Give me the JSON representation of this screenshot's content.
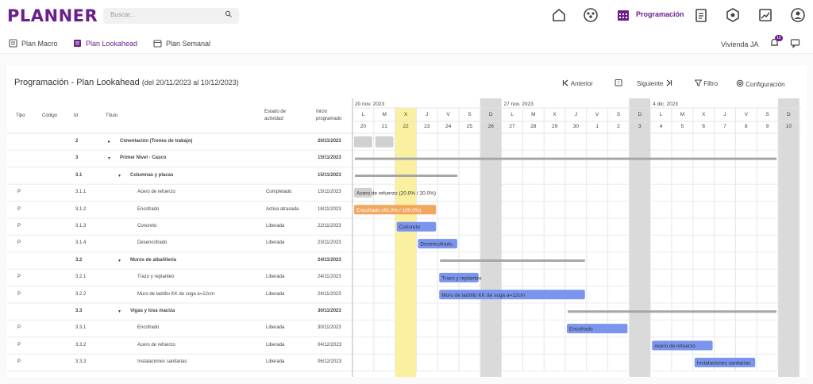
{
  "app": {
    "logo": "PLANNER",
    "search_placeholder": "Buscar...",
    "nav_active": "Programación",
    "user": "Vivienda JA",
    "notif_count": "10"
  },
  "subtabs": [
    {
      "label": "Plan Macro"
    },
    {
      "label": "Plan Lookahead"
    },
    {
      "label": "Plan Semanal"
    }
  ],
  "panel": {
    "title": "Programación - Plan Lookahead",
    "range": "(del 20/11/2023 al 10/12/2023)",
    "toolbar": {
      "prev": "Anterior",
      "next": "Siguiente",
      "filter": "Filtro",
      "config": "Configuración"
    }
  },
  "columns": {
    "tipo": "Tipo",
    "codigo": "Código",
    "id": "Id",
    "titulo": "Título",
    "estado": "Estado de actividad",
    "inicio": "Inicio programado"
  },
  "weeks": [
    "20 nov. 2023",
    "27 nov. 2023",
    "4 dic. 2023"
  ],
  "day_letters": [
    "L",
    "M",
    "X",
    "J",
    "V",
    "S",
    "D",
    "L",
    "M",
    "X",
    "J",
    "V",
    "S",
    "D",
    "L",
    "M",
    "X",
    "J",
    "V",
    "S",
    "D"
  ],
  "day_numbers": [
    "20",
    "21",
    "22",
    "23",
    "24",
    "25",
    "26",
    "27",
    "28",
    "29",
    "30",
    "1",
    "2",
    "3",
    "4",
    "5",
    "6",
    "7",
    "8",
    "9",
    "10"
  ],
  "rows": [
    {
      "tipo": "",
      "id": "2",
      "title": "Cimentación (Trenes de trabajo)",
      "estado": "",
      "inicio": "20/11/2023",
      "level": 0,
      "bold": true,
      "arrow": "▸"
    },
    {
      "tipo": "",
      "id": "3",
      "title": "Primer Nivel - Casco",
      "estado": "",
      "inicio": "15/11/2023",
      "level": 0,
      "bold": true,
      "arrow": "▾"
    },
    {
      "tipo": "",
      "id": "3.1",
      "title": "Columnas y placas",
      "estado": "",
      "inicio": "15/11/2023",
      "level": 1,
      "bold": true,
      "arrow": "▾"
    },
    {
      "tipo": "P",
      "id": "3.1.1",
      "title": "Acero de refuerzo",
      "estado": "Completado",
      "inicio": "15/11/2023",
      "level": 2,
      "bold": false,
      "arrow": ""
    },
    {
      "tipo": "P",
      "id": "3.1.2",
      "title": "Encofrado",
      "estado": "Activa atrasada",
      "inicio": "18/11/2023",
      "level": 2,
      "bold": false,
      "arrow": ""
    },
    {
      "tipo": "P",
      "id": "3.1.3",
      "title": "Concreto",
      "estado": "Liberada",
      "inicio": "22/11/2023",
      "level": 2,
      "bold": false,
      "arrow": ""
    },
    {
      "tipo": "P",
      "id": "3.1.4",
      "title": "Desencofrado",
      "estado": "Liberada",
      "inicio": "23/11/2023",
      "level": 2,
      "bold": false,
      "arrow": ""
    },
    {
      "tipo": "",
      "id": "3.2",
      "title": "Muros de albañilería",
      "estado": "",
      "inicio": "24/11/2023",
      "level": 1,
      "bold": true,
      "arrow": "▾"
    },
    {
      "tipo": "P",
      "id": "3.2.1",
      "title": "Trazo y replanteo",
      "estado": "Liberada",
      "inicio": "24/11/2023",
      "level": 2,
      "bold": false,
      "arrow": ""
    },
    {
      "tipo": "P",
      "id": "3.2.2",
      "title": "Muro de ladrillo KK de soga a=12cm",
      "estado": "Liberada",
      "inicio": "24/11/2023",
      "level": 2,
      "bold": false,
      "arrow": ""
    },
    {
      "tipo": "",
      "id": "3.3",
      "title": "Vigas y losa maciza",
      "estado": "",
      "inicio": "30/11/2023",
      "level": 1,
      "bold": true,
      "arrow": "▾"
    },
    {
      "tipo": "P",
      "id": "3.3.1",
      "title": "Encofrado",
      "estado": "Liberada",
      "inicio": "30/11/2023",
      "level": 2,
      "bold": false,
      "arrow": ""
    },
    {
      "tipo": "P",
      "id": "3.3.2",
      "title": "Acero de refuerzo",
      "estado": "Liberada",
      "inicio": "04/12/2023",
      "level": 2,
      "bold": false,
      "arrow": ""
    },
    {
      "tipo": "P",
      "id": "3.3.3",
      "title": "Instalaciones sanitarias",
      "estado": "Liberada",
      "inicio": "06/12/2023",
      "level": 2,
      "bold": false,
      "arrow": ""
    }
  ],
  "bars": [
    {
      "row": 0,
      "type": "box",
      "start": 0,
      "dur": 1,
      "label": ""
    },
    {
      "row": 0,
      "type": "box",
      "start": 1,
      "dur": 1,
      "label": ""
    },
    {
      "row": 1,
      "type": "sum",
      "start": 0,
      "dur": 20,
      "label": ""
    },
    {
      "row": 2,
      "type": "sum",
      "start": 0,
      "dur": 5,
      "label": ""
    },
    {
      "row": 3,
      "type": "grey",
      "start": 0,
      "dur": 1,
      "label": "Acero de refuerzo (20.0% / 20.0%)"
    },
    {
      "row": 4,
      "type": "orange",
      "start": 0,
      "dur": 4,
      "label": "Encofrado (45.0% / 100.0%)"
    },
    {
      "row": 5,
      "type": "blue",
      "start": 2,
      "dur": 2,
      "label": "Concreto"
    },
    {
      "row": 6,
      "type": "blue",
      "start": 3,
      "dur": 2,
      "label": "Desencofrado"
    },
    {
      "row": 7,
      "type": "sum",
      "start": 4,
      "dur": 7,
      "label": ""
    },
    {
      "row": 8,
      "type": "blue",
      "start": 4,
      "dur": 2,
      "label": "Trazo y replanteo"
    },
    {
      "row": 9,
      "type": "blue",
      "start": 4,
      "dur": 7,
      "label": "Muro de ladrillo KK de soga a=12cm"
    },
    {
      "row": 10,
      "type": "sum",
      "start": 10,
      "dur": 10,
      "label": ""
    },
    {
      "row": 11,
      "type": "blue",
      "start": 10,
      "dur": 3,
      "label": "Encofrado"
    },
    {
      "row": 12,
      "type": "blue",
      "start": 14,
      "dur": 3,
      "label": "Acero de refuerzo"
    },
    {
      "row": 13,
      "type": "blue",
      "start": 16,
      "dur": 3,
      "label": "Instalaciones sanitarias"
    }
  ],
  "colors": {
    "accent": "#6a1f8c",
    "today": "#fbf0a0",
    "weekend": "#d9d9d9",
    "blue": "#7b95ee",
    "orange": "#f2a760"
  }
}
